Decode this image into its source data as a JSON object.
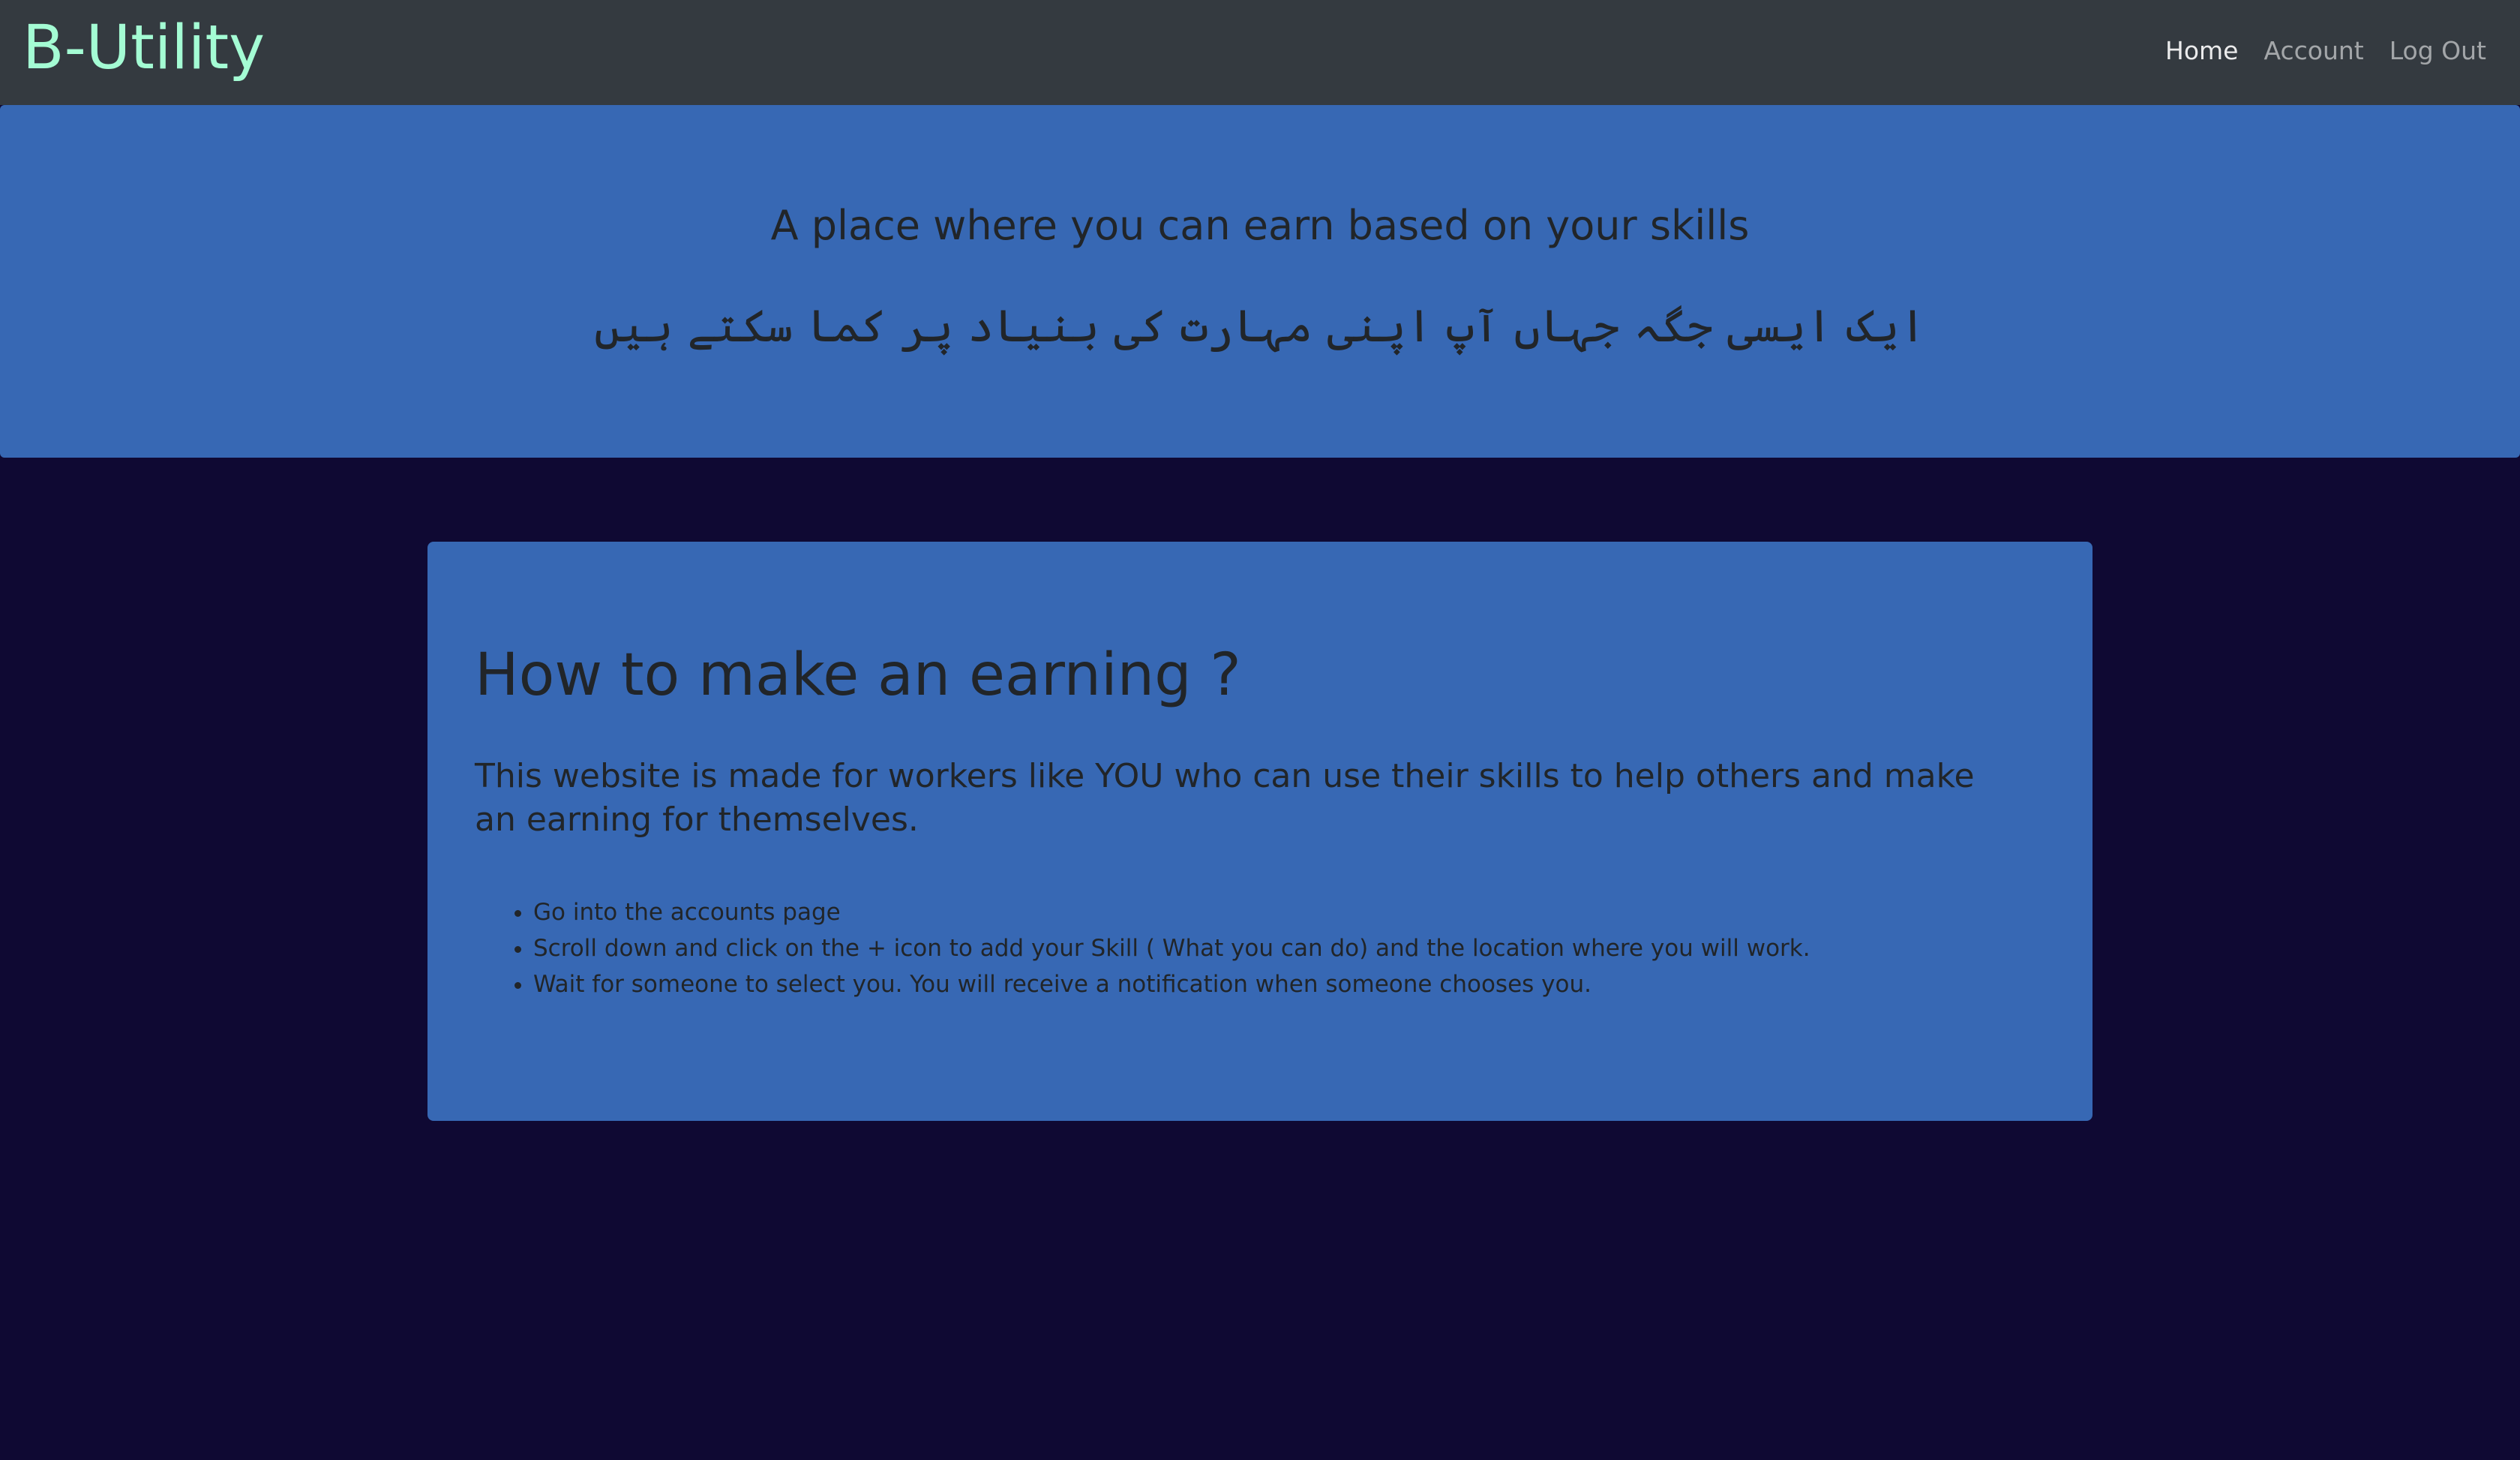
{
  "navbar": {
    "brand": "B-Utility",
    "links": [
      {
        "label": "Home",
        "active": true
      },
      {
        "label": "Account",
        "active": false
      },
      {
        "label": "Log Out",
        "active": false
      }
    ]
  },
  "hero": {
    "title": "A place where you can earn based on your skills",
    "urdu_title": "ایک ایسی جگہ جہاں آپ اپنی مہارت کی بنیاد پر کما سکتے ہیں"
  },
  "card": {
    "title": "How to make an earning ?",
    "lead": "This website is made for workers like YOU who can use their skills to help others and make an earning for themselves.",
    "steps": [
      "Go into the accounts page",
      "Scroll down and click on the + icon to add your Skill ( What you can do) and the location where you will work.",
      "Wait for someone to select you. You will receive a notification when someone chooses you."
    ]
  },
  "colors": {
    "navbar_bg": "#343a40",
    "brand": "#a4fcd4",
    "page_bg": "#0f0933",
    "panel_bg": "#3768b4",
    "text": "#212529"
  }
}
